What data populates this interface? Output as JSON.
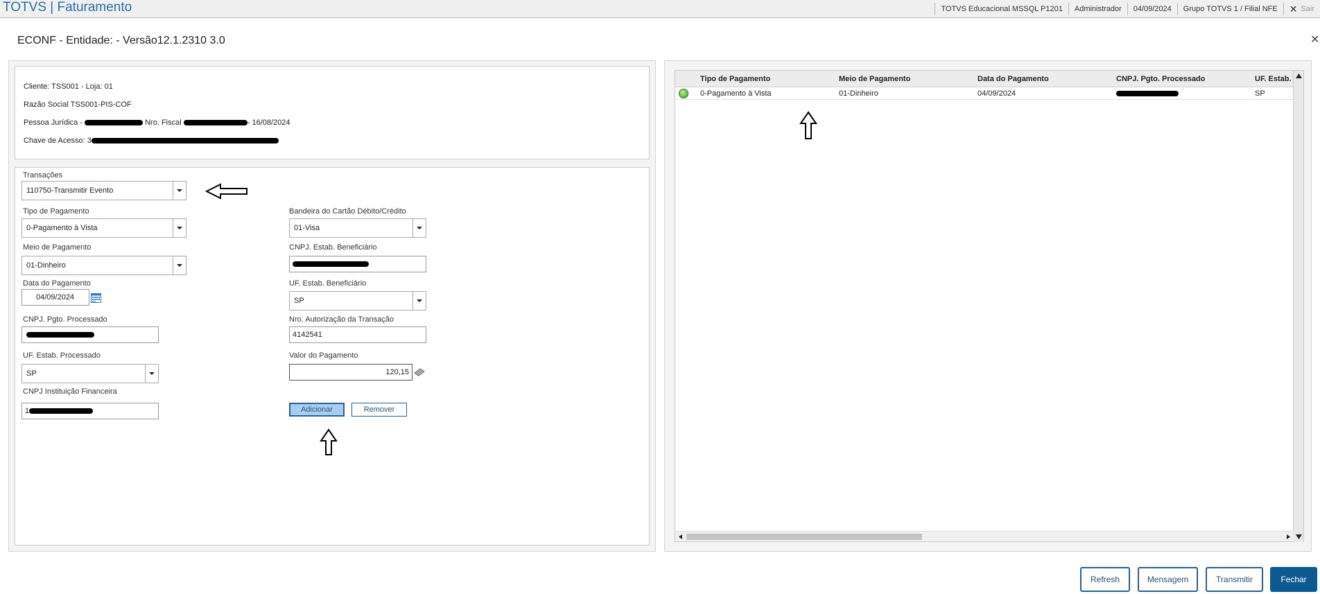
{
  "header": {
    "brand": "TOTVS | Faturamento",
    "environment": "TOTVS Educacional MSSQL P1201",
    "user": "Administrador",
    "date": "04/09/2024",
    "branch": "Grupo TOTVS 1 / Filial NFE",
    "exit_label": "Sair"
  },
  "dialog": {
    "title": "ECONF - Entidade: - Versão12.1.2310  3.0",
    "close_icon": "close-icon"
  },
  "info": {
    "cliente": "Cliente: TSS001 - Loja: 01",
    "razao": "Razão Social TSS001-PIS-COF",
    "pessoa_prefix": "Pessoa Jurídica - ",
    "nro_fiscal_label": " Nro. Fiscal ",
    "nro_fiscal_suffix": "- 16/08/2024",
    "chave_prefix": "Chave de Acesso: 3"
  },
  "form": {
    "transacoes_label": "Transações",
    "transacoes_value": "110750-Transmitir Evento",
    "tipo_pagamento_label": "Tipo de Pagamento",
    "tipo_pagamento_value": "0-Pagamento à Vista",
    "meio_pagamento_label": "Meio de Pagamento",
    "meio_pagamento_value": "01-Dinheiro",
    "data_pagamento_label": "Data do Pagamento",
    "data_pagamento_value": "04/09/2024",
    "cnpj_processado_label": "CNPJ. Pgto. Processado",
    "uf_processado_label": "UF. Estab. Processado",
    "uf_processado_value": "SP",
    "cnpj_instituicao_label": "CNPJ Instituição Financeira",
    "cnpj_instituicao_prefix": "1",
    "bandeira_label": "Bandeira do Cartão Débito/Crédito",
    "bandeira_value": "01-Visa",
    "cnpj_beneficiario_label": "CNPJ. Estab. Beneficiário",
    "uf_beneficiario_label": "UF. Estab. Beneficiário",
    "uf_beneficiario_value": "SP",
    "nro_autorizacao_label": "Nro. Autorização da Transação",
    "nro_autorizacao_value": "4142541",
    "valor_label": "Valor do Pagamento",
    "valor_value": "120,15",
    "adicionar_label": "Adicionar",
    "remover_label": "Remover"
  },
  "grid": {
    "columns": [
      "Tipo de Pagamento",
      "Meio de Pagamento",
      "Data do Pagamento",
      "CNPJ. Pgto. Processado",
      "UF. Estab."
    ],
    "rows": [
      {
        "tipo": "0-Pagamento à Vista",
        "meio": "01-Dinheiro",
        "data": "04/09/2024",
        "uf": "SP",
        "status": "green"
      }
    ]
  },
  "footer": {
    "refresh": "Refresh",
    "mensagem": "Mensagem",
    "transmitir": "Transmitir",
    "fechar": "Fechar"
  },
  "colors": {
    "brand": "#2b6ca8",
    "primary_button": "#0d5a93",
    "button_border": "#2c5f93",
    "status_ok": "#3e9a24"
  }
}
